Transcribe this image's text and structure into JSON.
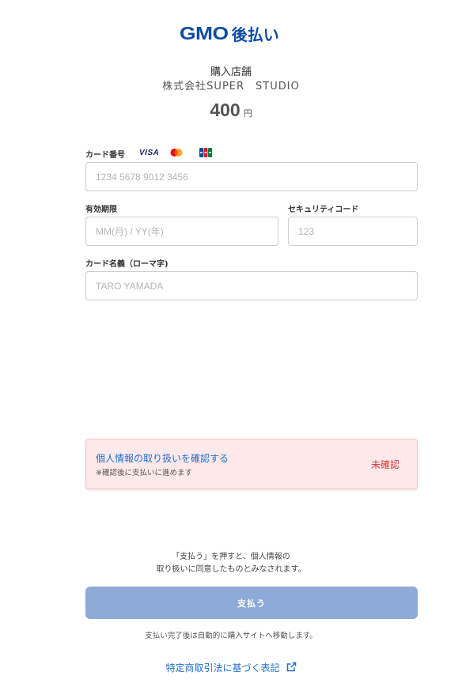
{
  "header": {
    "logo_gmo": "GMO",
    "logo_text": "後払い"
  },
  "shop": {
    "label": "購入店舗",
    "name": "株式会社SUPER　STUDIO"
  },
  "amount": {
    "value": "400",
    "unit": "円"
  },
  "card_form": {
    "card_number": {
      "label": "カード番号",
      "placeholder": "1234 5678 9012 3456",
      "value": ""
    },
    "brands": {
      "visa": "VISA",
      "mastercard_icon": "mastercard-logo-icon",
      "jcb_icon": "jcb-logo-icon"
    },
    "expiry": {
      "label": "有効期限",
      "placeholder": "MM(月) / YY(年)",
      "value": ""
    },
    "security_code": {
      "label": "セキュリティコード",
      "placeholder": "123",
      "value": ""
    },
    "holder_name": {
      "label": "カード名義（ローマ字)",
      "placeholder": "TARO YAMADA",
      "value": ""
    }
  },
  "privacy_notice": {
    "title": "個人情報の取り扱いを確認する",
    "subtitle": "※確認後に支払いに進めます",
    "status": "未確認"
  },
  "agreement": {
    "line1": "「支払う」を押すと、個人情報の",
    "line2": "取り扱いに同意したものとみなされます。"
  },
  "pay_button": {
    "label": "支払う",
    "disabled": true
  },
  "redirect_note": "支払い完了後は自動的に購入サイトへ移動します。",
  "footer": {
    "law_link": "特定商取引法に基づく表記",
    "law_link_icon": "external-link-icon"
  },
  "colors": {
    "brand_blue": "#0e4da4",
    "link_blue": "#1e6fcf",
    "button_disabled": "#8eaad6",
    "notice_bg": "#fde8ea",
    "status_red": "#d9383d"
  }
}
